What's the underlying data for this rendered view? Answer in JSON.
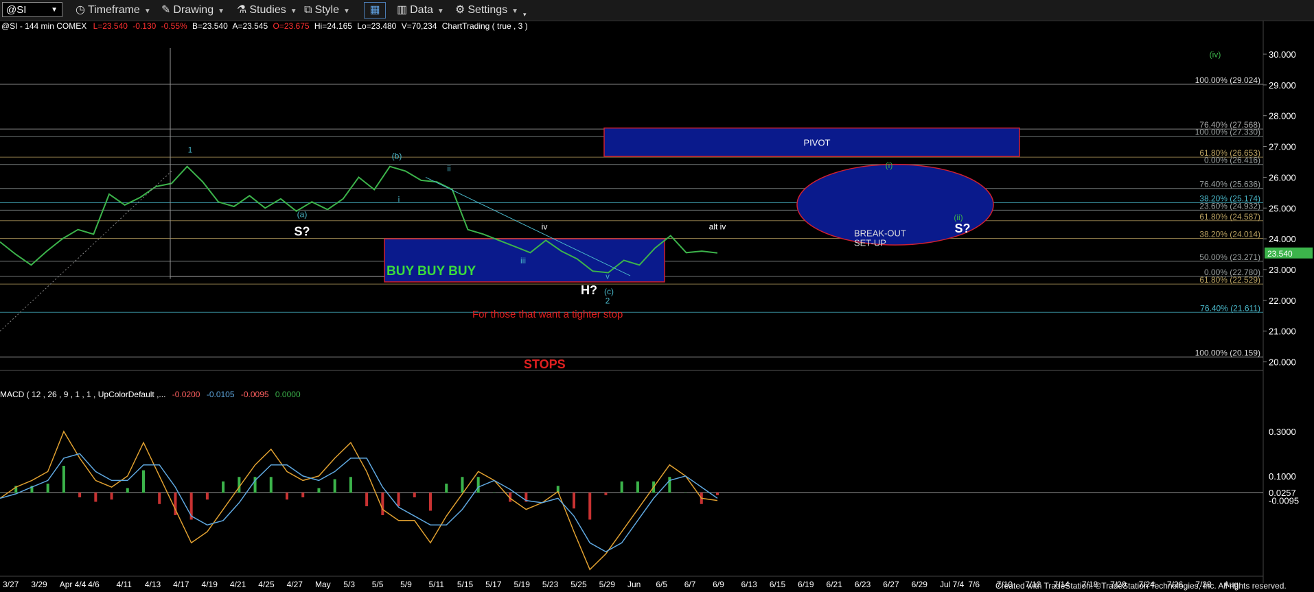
{
  "toolbar": {
    "symbol": "@SI",
    "items": [
      "Timeframe",
      "Drawing",
      "Studies",
      "Style",
      "Data",
      "Settings"
    ]
  },
  "header": {
    "symbol_line": "@SI - 144 min  COMEX",
    "last": "L=23.540",
    "chg": "-0.130",
    "pct": "-0.55%",
    "bid": "B=23.540",
    "ask": "A=23.545",
    "open": "O=23.675",
    "high": "Hi=24.165",
    "low": "Lo=23.480",
    "vol": "V=70,234",
    "study": "ChartTrading ( true , 3 )"
  },
  "colors": {
    "background": "#000000",
    "price_bar": "#3cb44b",
    "box_fill": "#0a1a8c",
    "box_border": "#d02030",
    "annotation_red": "#e02020",
    "wave_label": "#49b6c8",
    "macd_line": "#e0a030",
    "signal_line": "#5fa8e0",
    "hist_pos": "#3cb44b",
    "hist_neg": "#c83232"
  },
  "chart_data": [
    {
      "type": "line",
      "title": "@SI - 144 min COMEX",
      "ylim": [
        19.5,
        30.2
      ],
      "y_ticks": [
        "30.000",
        "29.000",
        "28.000",
        "27.000",
        "26.000",
        "25.000",
        "24.000",
        "23.000",
        "22.000",
        "21.000",
        "20.000"
      ],
      "last_price": "23.540",
      "x_labels": [
        "3/27",
        "3/29",
        "Apr 4/4",
        "4/6",
        "4/11",
        "4/13",
        "4/17",
        "4/19",
        "4/21",
        "4/25",
        "4/27",
        "May",
        "5/3",
        "5/5",
        "5/9",
        "5/11",
        "5/15",
        "5/17",
        "5/19",
        "5/23",
        "5/25",
        "5/29",
        "Jun",
        "6/5",
        "6/7",
        "6/9",
        "6/13",
        "6/15",
        "6/19",
        "6/21",
        "6/23",
        "6/27",
        "6/29",
        "Jul 7/4",
        "7/6",
        "7/10",
        "7/12",
        "7/14",
        "7/18",
        "7/20",
        "7/24",
        "7/26",
        "7/28",
        "Aug"
      ],
      "price_path": [
        [
          0,
          23.9
        ],
        [
          1,
          23.5
        ],
        [
          2,
          23.15
        ],
        [
          3,
          23.6
        ],
        [
          4,
          24.0
        ],
        [
          5,
          24.3
        ],
        [
          6,
          24.15
        ],
        [
          7,
          25.45
        ],
        [
          8,
          25.1
        ],
        [
          9,
          25.35
        ],
        [
          10,
          25.7
        ],
        [
          11,
          25.8
        ],
        [
          12,
          26.35
        ],
        [
          13,
          25.85
        ],
        [
          14,
          25.2
        ],
        [
          15,
          25.05
        ],
        [
          16,
          25.4
        ],
        [
          17,
          25.0
        ],
        [
          18,
          25.3
        ],
        [
          19,
          24.9
        ],
        [
          20,
          25.2
        ],
        [
          21,
          24.95
        ],
        [
          22,
          25.3
        ],
        [
          23,
          26.0
        ],
        [
          24,
          25.6
        ],
        [
          25,
          26.35
        ],
        [
          26,
          26.2
        ],
        [
          27,
          25.9
        ],
        [
          28,
          25.85
        ],
        [
          29,
          25.6
        ],
        [
          30,
          24.3
        ],
        [
          31,
          24.15
        ],
        [
          32,
          23.95
        ],
        [
          33,
          23.75
        ],
        [
          34,
          23.55
        ],
        [
          35,
          23.95
        ],
        [
          36,
          23.6
        ],
        [
          37,
          23.35
        ],
        [
          38,
          22.95
        ],
        [
          39,
          22.9
        ],
        [
          40,
          23.3
        ],
        [
          41,
          23.15
        ],
        [
          42,
          23.7
        ],
        [
          43,
          24.1
        ],
        [
          44,
          23.55
        ],
        [
          45,
          23.6
        ],
        [
          46,
          23.54
        ]
      ],
      "fib_levels": [
        {
          "label": "76.40% (27.568)",
          "value": 27.568
        },
        {
          "label": "100.00% (27.330)",
          "value": 27.33
        },
        {
          "label": "61.80% (26.653)",
          "value": 26.653
        },
        {
          "label": "0.00% (26.416)",
          "value": 26.416
        },
        {
          "label": "76.40% (25.636)",
          "value": 25.636
        },
        {
          "label": "38.20% (25.174)",
          "value": 25.174
        },
        {
          "label": "23.60% (24.932)",
          "value": 24.932
        },
        {
          "label": "61.80% (24.587)",
          "value": 24.587
        },
        {
          "label": "38.20% (24.014)",
          "value": 24.014
        },
        {
          "label": "50.00% (23.271)",
          "value": 23.271
        },
        {
          "label": "0.00% (22.780)",
          "value": 22.78
        },
        {
          "label": "61.80% (22.529)",
          "value": 22.529
        },
        {
          "label": "76.40% (21.611)",
          "value": 21.611
        },
        {
          "label": "100.00% (29.024)",
          "value": 29.024
        },
        {
          "label": "100.00% (20.159)",
          "value": 20.159
        }
      ],
      "zones": [
        {
          "label": "PIVOT",
          "ytop": 27.6,
          "ybottom": 26.68
        },
        {
          "label": "BUY BUY BUY",
          "ytop": 24.0,
          "ybottom": 22.6
        },
        {
          "label": "BREAK-OUT SET-UP",
          "shape": "ellipse",
          "ytop": 26.42,
          "ybottom": 23.8
        }
      ],
      "wave_labels": [
        {
          "text": "1",
          "at": 26.8
        },
        {
          "text": "(b)",
          "at": 26.6
        },
        {
          "text": "ii",
          "at": 26.2
        },
        {
          "text": "i",
          "at": 25.2
        },
        {
          "text": "(a)",
          "at": 24.7
        },
        {
          "text": "S?",
          "at": 24.1
        },
        {
          "text": "iv",
          "at": 24.3
        },
        {
          "text": "iii",
          "at": 23.2
        },
        {
          "text": "H?",
          "at": 22.2
        },
        {
          "text": "v",
          "at": 22.7
        },
        {
          "text": "(c)",
          "at": 22.2
        },
        {
          "text": "2",
          "at": 21.9
        },
        {
          "text": "alt iv",
          "at": 24.3
        },
        {
          "text": "(iv)",
          "at": 29.9
        },
        {
          "text": "(i)",
          "at": 26.3
        },
        {
          "text": "(ii)",
          "at": 24.6
        },
        {
          "text": "S?",
          "at": 24.2
        }
      ],
      "annotations": [
        "For those that want a tighter stop",
        "STOPS"
      ]
    },
    {
      "type": "line",
      "title": "MACD ( 12 , 26 , 9 , 1 , 1 , UpColorDefault ,...",
      "values_text": [
        "-0.0200",
        "-0.0105",
        "-0.0095",
        "0.0000"
      ],
      "y_ticks": [
        "0.3000",
        "0.1000",
        "0.0257",
        "-0.0095"
      ],
      "ylim": [
        -0.35,
        0.42
      ],
      "series": [
        {
          "values": [
            0.0,
            0.05,
            0.08,
            0.12,
            0.3,
            0.18,
            0.08,
            0.05,
            0.1,
            0.25,
            0.1,
            -0.05,
            -0.2,
            -0.15,
            -0.05,
            0.05,
            0.15,
            0.22,
            0.12,
            0.08,
            0.1,
            0.18,
            0.25,
            0.12,
            -0.05,
            -0.1,
            -0.1,
            -0.2,
            -0.08,
            0.02,
            0.12,
            0.08,
            0.0,
            -0.05,
            -0.02,
            0.03,
            -0.15,
            -0.32,
            -0.25,
            -0.15,
            -0.05,
            0.05,
            0.15,
            0.1,
            0.0,
            -0.01
          ]
        },
        {
          "values": [
            0.0,
            0.02,
            0.05,
            0.08,
            0.18,
            0.2,
            0.12,
            0.08,
            0.08,
            0.15,
            0.15,
            0.05,
            -0.08,
            -0.12,
            -0.1,
            -0.02,
            0.08,
            0.15,
            0.15,
            0.1,
            0.08,
            0.12,
            0.18,
            0.18,
            0.05,
            -0.04,
            -0.08,
            -0.12,
            -0.12,
            -0.05,
            0.05,
            0.08,
            0.04,
            -0.01,
            -0.02,
            0.0,
            -0.08,
            -0.2,
            -0.24,
            -0.2,
            -0.1,
            0.0,
            0.08,
            0.1,
            0.05,
            0.0
          ]
        }
      ]
    }
  ],
  "footer": {
    "text": "Created with TradeStation. ©TradeStation Technologies, Inc. All rights reserved."
  }
}
